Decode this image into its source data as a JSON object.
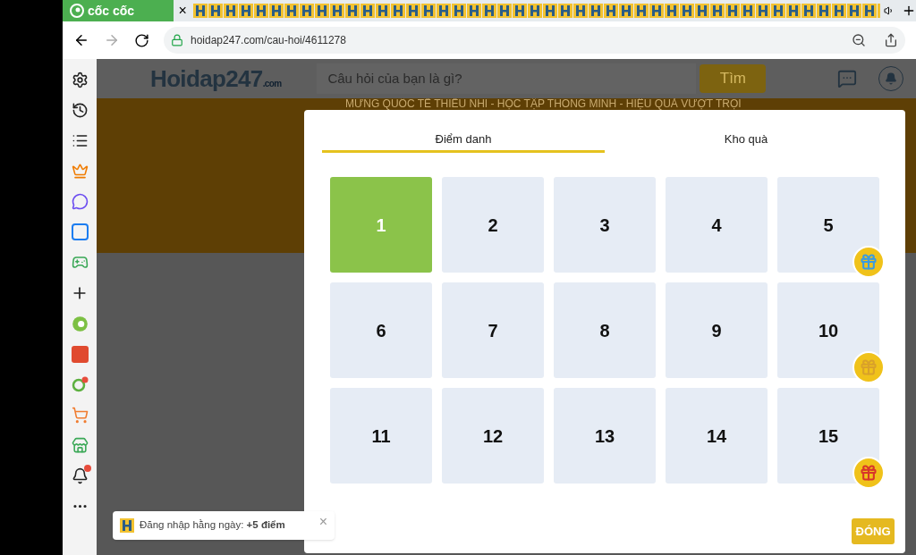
{
  "browser": {
    "brand": "cốc cốc",
    "tab_close": "×",
    "url": "hoidap247.com/cau-hoi/4611278"
  },
  "site": {
    "logo": "Hoidap247",
    "logo_sub": ".com",
    "search_placeholder": "Câu hỏi của bạn là gì?",
    "search_button": "Tìm",
    "banner": "MỪNG QUỐC TẾ THIẾU NHI - HỌC TẬP THÔNG MINH - HIỆU QUẢ VƯỢT TRỘI"
  },
  "sidebar": {
    "notification_badge": true
  },
  "modal": {
    "tabs": [
      {
        "label": "Điểm danh",
        "selected": true
      },
      {
        "label": "Kho quà",
        "selected": false
      }
    ],
    "days": [
      {
        "label": "1",
        "checked": true
      },
      {
        "label": "2",
        "checked": false
      },
      {
        "label": "3",
        "checked": false
      },
      {
        "label": "4",
        "checked": false
      },
      {
        "label": "5",
        "checked": false,
        "gift": {
          "color": "#3b9be0"
        }
      },
      {
        "label": "6",
        "checked": false
      },
      {
        "label": "7",
        "checked": false
      },
      {
        "label": "8",
        "checked": false
      },
      {
        "label": "9",
        "checked": false
      },
      {
        "label": "10",
        "checked": false,
        "gift": {
          "color": "#d9a12a"
        }
      },
      {
        "label": "11",
        "checked": false
      },
      {
        "label": "12",
        "checked": false
      },
      {
        "label": "13",
        "checked": false
      },
      {
        "label": "14",
        "checked": false
      },
      {
        "label": "15",
        "checked": false,
        "gift": {
          "color": "#d8352a"
        }
      }
    ],
    "close_button": "ĐÓNG"
  },
  "toast": {
    "text": "Đăng nhập hằng ngày: **+5 điểm**",
    "close": "×"
  }
}
